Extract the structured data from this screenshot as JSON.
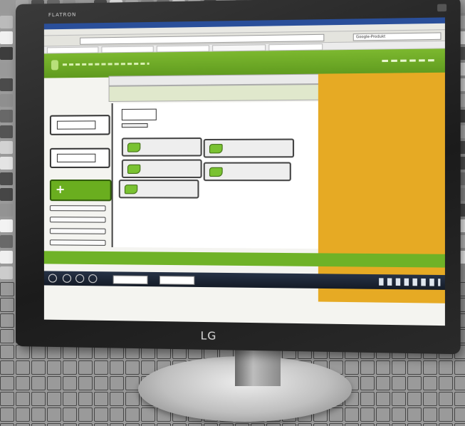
{
  "monitor": {
    "brand": "FLATRON",
    "model": "",
    "logo": "LG"
  },
  "browser": {
    "search_placeholder": "Google-Produkt"
  },
  "colors": {
    "app_green": "#6fb227",
    "accent_orange": "#e6aa24",
    "taskbar": "#1d2535",
    "bezel": "#222222"
  },
  "icons": [
    "plus-icon",
    "leaf-icon",
    "document-icon",
    "start-orb-icon"
  ]
}
